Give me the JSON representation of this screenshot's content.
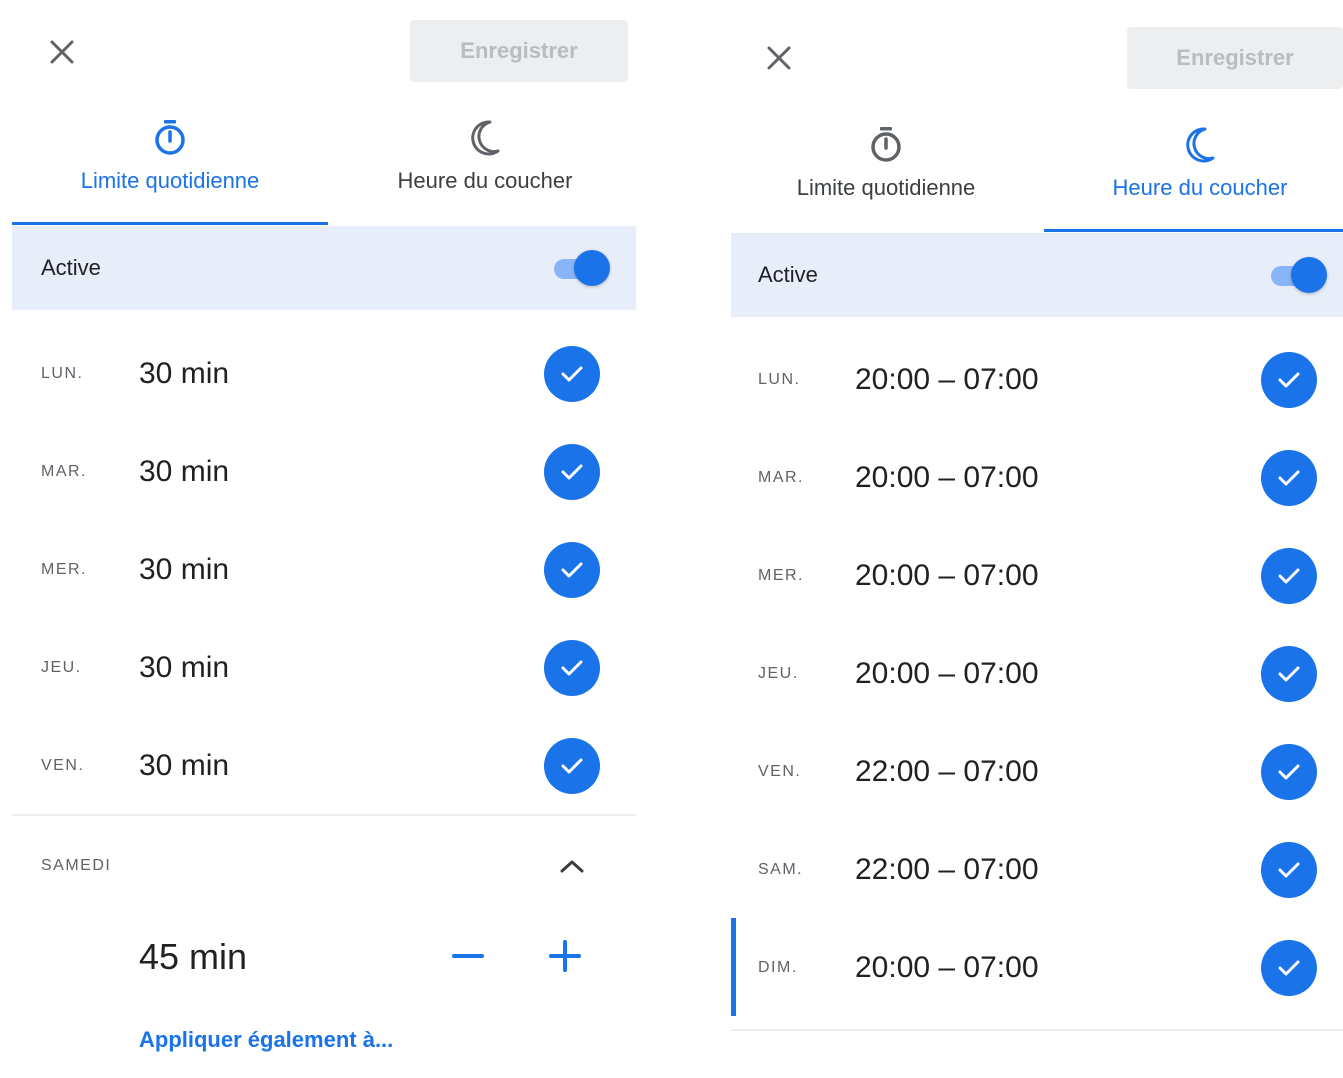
{
  "colors": {
    "accent": "#1a73e8",
    "active_row_bg": "#e8eef9",
    "save_disabled_bg": "#eceeef",
    "save_disabled_text": "#b9bcc0"
  },
  "left_panel": {
    "close_icon": "close-icon",
    "save_label": "Enregistrer",
    "tabs": [
      {
        "label": "Limite quotidienne",
        "icon": "timer-icon",
        "active": true
      },
      {
        "label": "Heure du coucher",
        "icon": "moon-icon",
        "active": false
      }
    ],
    "active_label": "Active",
    "toggle_on": true,
    "days": [
      {
        "abbr": "LUN.",
        "value": "30 min",
        "checked": true
      },
      {
        "abbr": "MAR.",
        "value": "30 min",
        "checked": true
      },
      {
        "abbr": "MER.",
        "value": "30 min",
        "checked": true
      },
      {
        "abbr": "JEU.",
        "value": "30 min",
        "checked": true
      },
      {
        "abbr": "VEN.",
        "value": "30 min",
        "checked": true
      }
    ],
    "expanded_day": {
      "label": "SAMEDI",
      "value": "45 min",
      "decrement_icon": "minus-icon",
      "increment_icon": "plus-icon",
      "apply_link": "Appliquer également à..."
    }
  },
  "right_panel": {
    "close_icon": "close-icon",
    "save_label": "Enregistrer",
    "tabs": [
      {
        "label": "Limite quotidienne",
        "icon": "timer-icon",
        "active": false
      },
      {
        "label": "Heure du coucher",
        "icon": "moon-icon",
        "active": true
      }
    ],
    "active_label": "Active",
    "toggle_on": true,
    "days": [
      {
        "abbr": "LUN.",
        "value": "20:00 – 07:00",
        "checked": true
      },
      {
        "abbr": "MAR.",
        "value": "20:00 – 07:00",
        "checked": true
      },
      {
        "abbr": "MER.",
        "value": "20:00 – 07:00",
        "checked": true
      },
      {
        "abbr": "JEU.",
        "value": "20:00 – 07:00",
        "checked": true
      },
      {
        "abbr": "VEN.",
        "value": "22:00 – 07:00",
        "checked": true
      },
      {
        "abbr": "SAM.",
        "value": "22:00 – 07:00",
        "checked": true
      },
      {
        "abbr": "DIM.",
        "value": "20:00 – 07:00",
        "checked": true
      }
    ]
  }
}
